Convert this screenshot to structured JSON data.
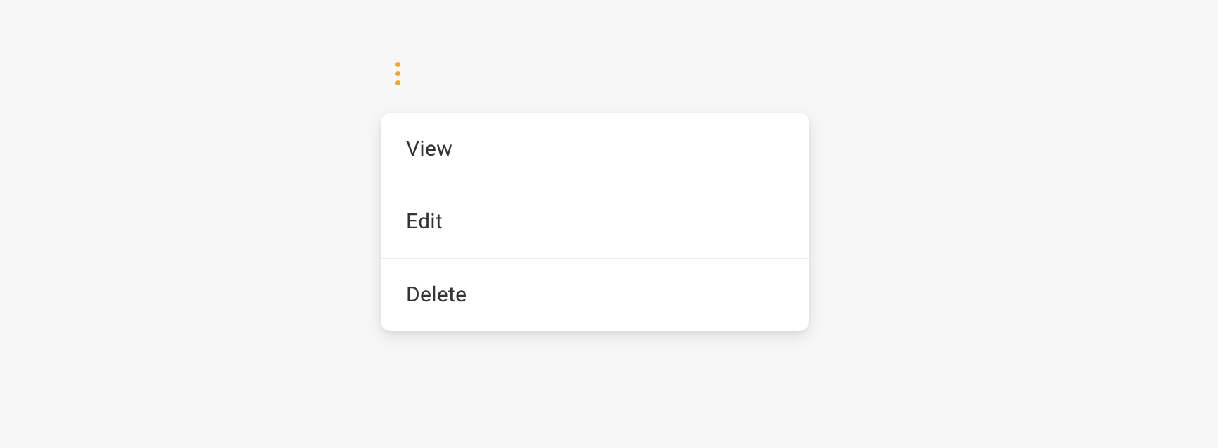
{
  "menu": {
    "trigger_icon": "more-vert",
    "items": [
      {
        "label": "View"
      },
      {
        "label": "Edit"
      },
      {
        "label": "Delete"
      }
    ]
  },
  "colors": {
    "accent": "#f5a623",
    "panel_bg": "#ffffff",
    "page_bg": "#f7f7f7",
    "text": "#333333",
    "divider": "#ececec"
  }
}
